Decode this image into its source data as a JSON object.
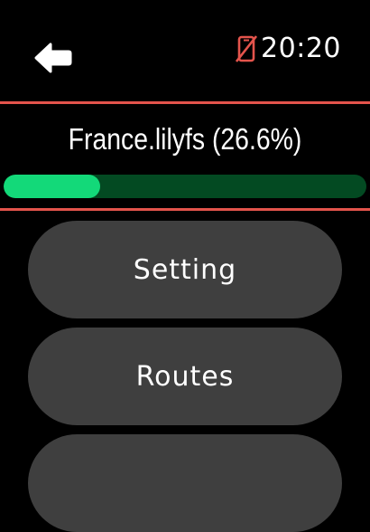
{
  "header": {
    "back_icon": "arrow-left-icon",
    "status_icon": "phone-disconnected-icon",
    "time": "20:20"
  },
  "download": {
    "title": "France.lilyfs (26.6%)",
    "progress_fraction": 0.266
  },
  "menu": {
    "items": [
      {
        "label": "Setting"
      },
      {
        "label": "Routes"
      },
      {
        "label": ""
      }
    ]
  },
  "colors": {
    "background": "#000000",
    "divider": "#e4544c",
    "status_icon": "#e4544c",
    "progress_fill": "#13d979",
    "progress_track": "#034a22",
    "button_bg": "#3f3f3f",
    "text": "#ffffff"
  }
}
